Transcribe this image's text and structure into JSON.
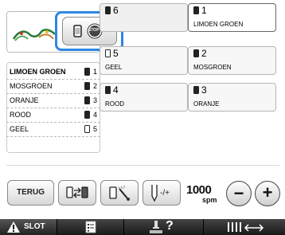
{
  "stop_button": {
    "icon": "stop-thread-icon",
    "label": "STOP"
  },
  "color_list": [
    {
      "name": "LIMOEN GROEN",
      "num": "1",
      "filled": true,
      "bold": true
    },
    {
      "name": "MOSGROEN",
      "num": "2",
      "filled": true
    },
    {
      "name": "ORANJE",
      "num": "3",
      "filled": true
    },
    {
      "name": "ROOD",
      "num": "4",
      "filled": true
    },
    {
      "name": "GEEL",
      "num": "5",
      "filled": false
    }
  ],
  "spool_grid": [
    {
      "num": "6",
      "name": "",
      "filled": true
    },
    {
      "num": "1",
      "name": "LIMOEN GROEN",
      "filled": true,
      "highlight": true
    },
    {
      "num": "5",
      "name": "GEEL",
      "filled": false
    },
    {
      "num": "2",
      "name": "MOSGROEN",
      "filled": true
    },
    {
      "num": "4",
      "name": "ROOD",
      "filled": true
    },
    {
      "num": "3",
      "name": "ORANJE",
      "filled": true
    }
  ],
  "toolbar": {
    "back_label": "TERUG",
    "speed_value": "1000",
    "speed_unit": "spm",
    "minus": "−",
    "plus": "+",
    "needle_adjust_label": "-/+"
  },
  "bottom_bar": {
    "slot_label": "SLOT",
    "help_label": "?"
  },
  "colors": {
    "accent_blue": "#2e86e6",
    "dark": "#1a1a1a"
  }
}
